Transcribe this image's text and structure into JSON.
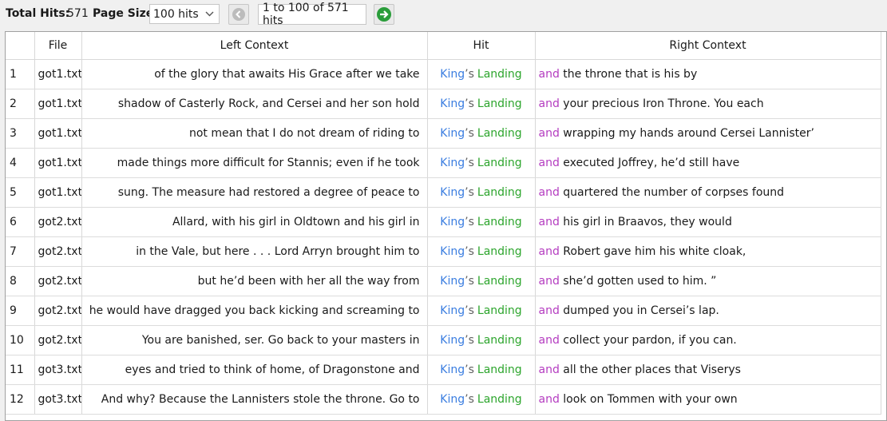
{
  "toolbar": {
    "total_hits_label": "Total Hits:",
    "total_hits_value": "571",
    "page_size_label": "Page Size",
    "page_size_value": "100 hits",
    "range_text": "1 to 100 of 571 hits"
  },
  "icons": {
    "prev": "left-arrow-circle-icon",
    "next": "right-arrow-circle-icon",
    "dropdown": "chevron-down-icon"
  },
  "colors": {
    "hit_part1": "#3a7de0",
    "hit_part2": "#2ca52c",
    "right_first_word": "#b43cc0",
    "next_button": "#2a9d3a"
  },
  "table": {
    "headers": [
      "",
      "File",
      "Left Context",
      "Hit",
      "Right Context"
    ],
    "rows": [
      {
        "num": "1",
        "file": "got1.txt",
        "left": "of the glory that awaits His Grace after we take",
        "hit1": "King",
        "hit_ap": "’s",
        "hit2": "Landing",
        "rfirst": "and",
        "rrest": "the throne that is his by"
      },
      {
        "num": "2",
        "file": "got1.txt",
        "left": "shadow of Casterly Rock, and Cersei and her son hold",
        "hit1": "King",
        "hit_ap": "’s",
        "hit2": "Landing",
        "rfirst": "and",
        "rrest": "your precious Iron Throne. You each"
      },
      {
        "num": "3",
        "file": "got1.txt",
        "left": "not mean that I do not dream of riding to",
        "hit1": "King",
        "hit_ap": "’s",
        "hit2": "Landing",
        "rfirst": "and",
        "rrest": "wrapping my hands around Cersei Lannister’"
      },
      {
        "num": "4",
        "file": "got1.txt",
        "left": "made things more difficult for Stannis; even if he took",
        "hit1": "King",
        "hit_ap": "’s",
        "hit2": "Landing",
        "rfirst": "and",
        "rrest": "executed Joffrey, he’d still have"
      },
      {
        "num": "5",
        "file": "got1.txt",
        "left": "sung. The measure had restored a degree of peace to",
        "hit1": "King",
        "hit_ap": "’s",
        "hit2": "Landing",
        "rfirst": "and",
        "rrest": "quartered the number of corpses found"
      },
      {
        "num": "6",
        "file": "got2.txt",
        "left": "Allard, with his girl in Oldtown and his girl in",
        "hit1": "King",
        "hit_ap": "’s",
        "hit2": "Landing",
        "rfirst": "and",
        "rrest": "his girl in Braavos, they would"
      },
      {
        "num": "7",
        "file": "got2.txt",
        "left": "in the Vale, but here . . . Lord Arryn brought him to",
        "hit1": "King",
        "hit_ap": "’s",
        "hit2": "Landing",
        "rfirst": "and",
        "rrest": "Robert gave him his white cloak,"
      },
      {
        "num": "8",
        "file": "got2.txt",
        "left": "but he’d been with her all the way from",
        "hit1": "King",
        "hit_ap": "’s",
        "hit2": "Landing",
        "rfirst": "and",
        "rrest": "she’d gotten used to him. ”"
      },
      {
        "num": "9",
        "file": "got2.txt",
        "left": "he would have dragged you back kicking and screaming to",
        "hit1": "King",
        "hit_ap": "’s",
        "hit2": "Landing",
        "rfirst": "and",
        "rrest": "dumped you in Cersei’s lap."
      },
      {
        "num": "10",
        "file": "got2.txt",
        "left": "You are banished, ser. Go back to your masters in",
        "hit1": "King",
        "hit_ap": "’s",
        "hit2": "Landing",
        "rfirst": "and",
        "rrest": "collect your pardon, if you can."
      },
      {
        "num": "11",
        "file": "got3.txt",
        "left": "eyes and tried to think of home, of Dragonstone and",
        "hit1": "King",
        "hit_ap": "’s",
        "hit2": "Landing",
        "rfirst": "and",
        "rrest": "all the other places that Viserys"
      },
      {
        "num": "12",
        "file": "got3.txt",
        "left": "And why? Because the Lannisters stole the throne. Go to",
        "hit1": "King",
        "hit_ap": "’s",
        "hit2": "Landing",
        "rfirst": "and",
        "rrest": "look on Tommen with your own"
      }
    ]
  }
}
